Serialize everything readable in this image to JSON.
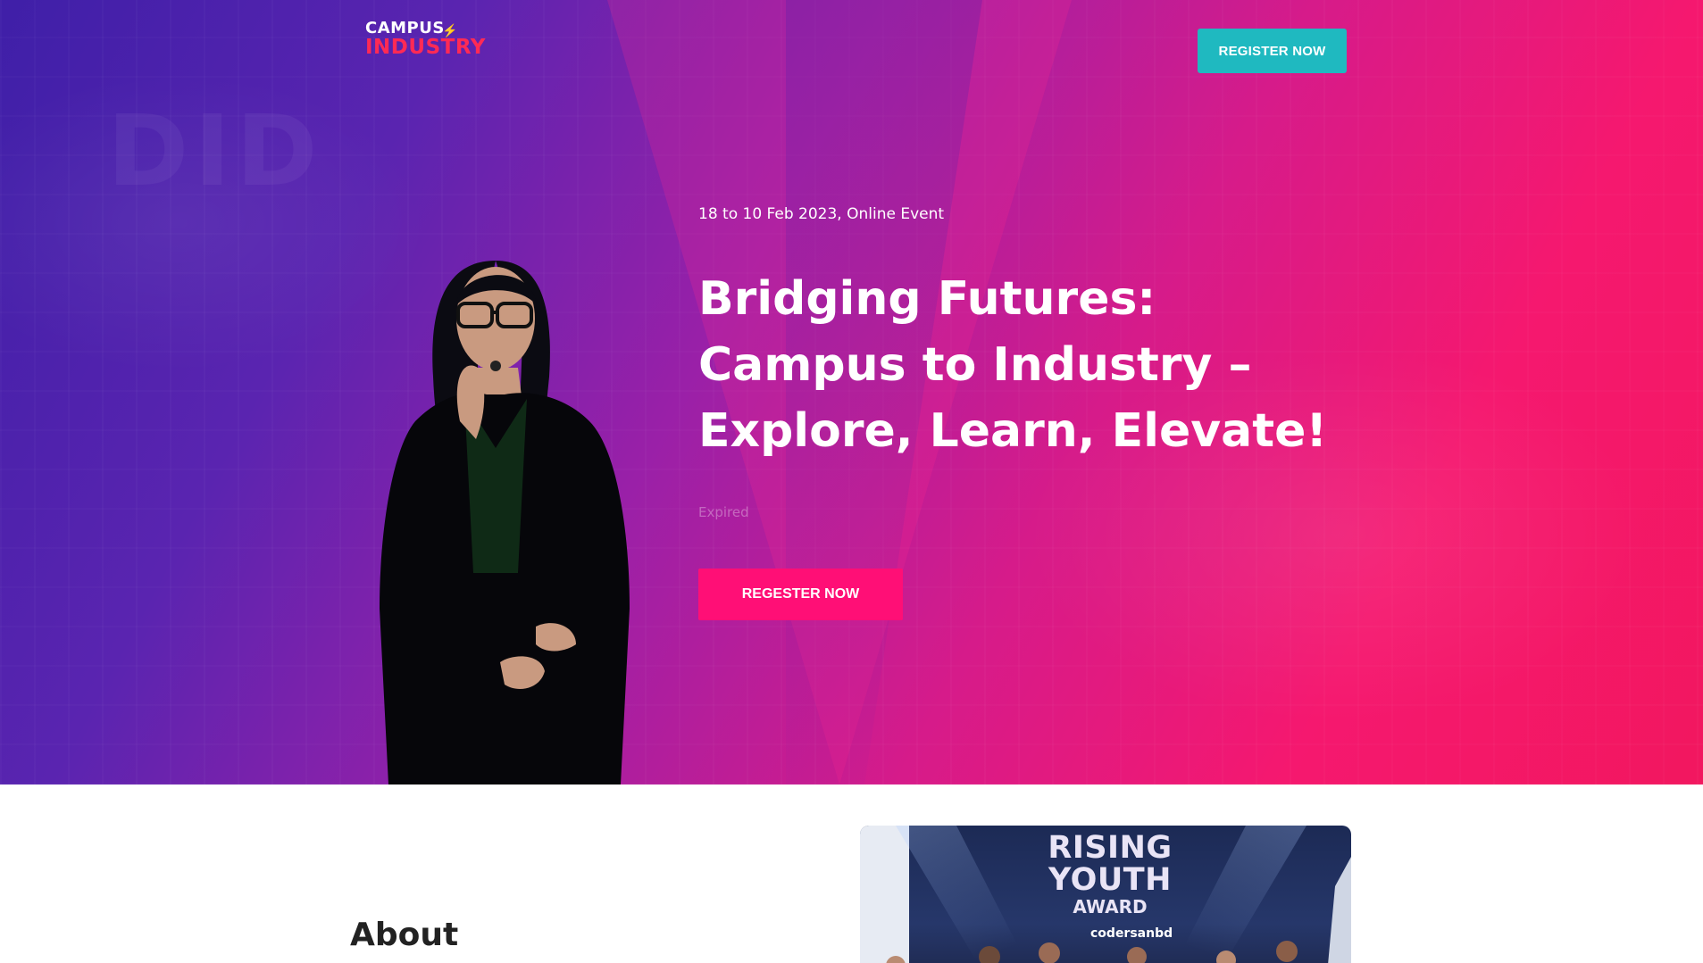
{
  "header": {
    "logo_line1": "CAMPUS",
    "logo_line2": "INDUSTRY",
    "register_label": "REGISTER NOW"
  },
  "hero": {
    "event_meta": "18 to 10 Feb 2023, Online Event",
    "title": "Bridging Futures: Campus to Industry – Explore, Learn, Elevate!",
    "countdown_status": "Expired",
    "cta_label": "REGESTER NOW",
    "background_ghost_text": "DID"
  },
  "about": {
    "title": "About",
    "photo": {
      "award_line1": "RISING",
      "award_line2": "YOUTH",
      "award_line3": "AWARD",
      "sponsor": "codersanbd"
    }
  },
  "colors": {
    "header_button": "#1fb9c0",
    "hero_button": "#ff0f76",
    "logo_accent": "#ff2a55",
    "hero_gradient_start": "#3f1fa8",
    "hero_gradient_end": "#f2175f"
  }
}
